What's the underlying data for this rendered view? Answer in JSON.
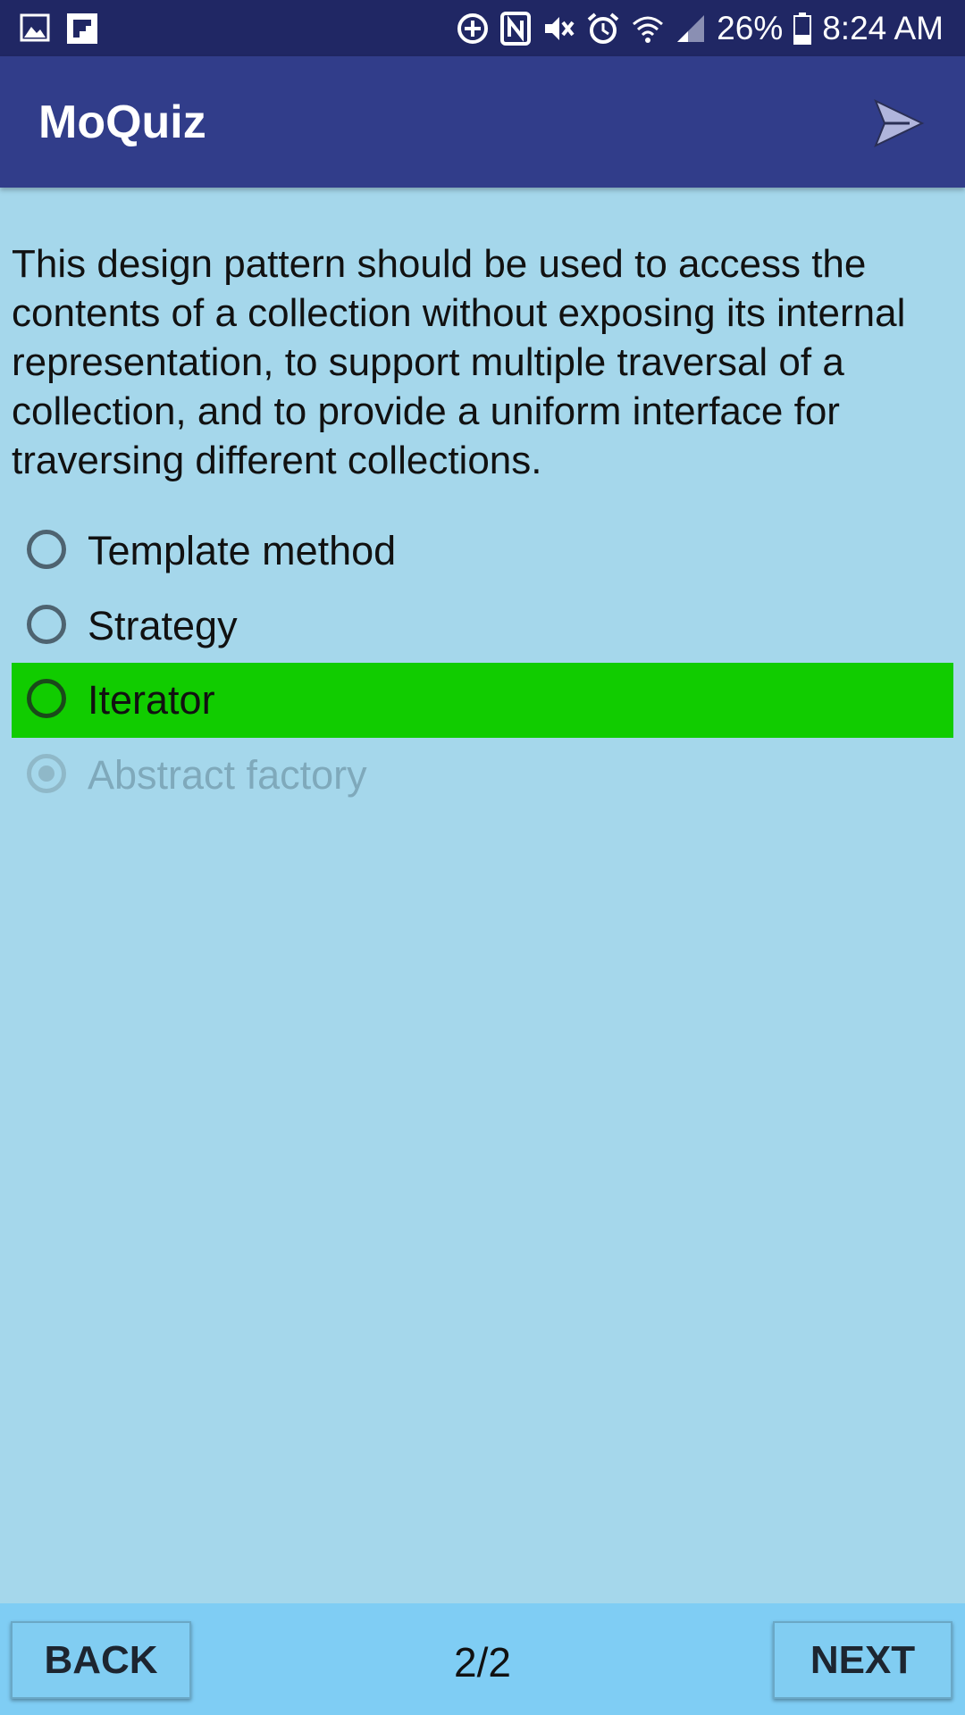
{
  "status_bar": {
    "icons_left": [
      "gallery-icon",
      "flipboard-icon"
    ],
    "icons_right": [
      "data-saver-icon",
      "nfc-icon",
      "mute-icon",
      "alarm-icon",
      "wifi-icon",
      "signal-icon",
      "battery-icon"
    ],
    "battery": "26%",
    "time": "8:24 AM"
  },
  "app_bar": {
    "title": "MoQuiz",
    "send_icon": "send-icon"
  },
  "question": {
    "text": "This design pattern should be used to access the contents of a collection without exposing its internal representation, to support multiple traversal of a collection, and to provide a uniform interface for traversing different collections."
  },
  "options": [
    {
      "label": "Template method",
      "state": "unselected"
    },
    {
      "label": "Strategy",
      "state": "unselected"
    },
    {
      "label": "Iterator",
      "state": "correct"
    },
    {
      "label": "Abstract factory",
      "state": "selected-disabled"
    }
  ],
  "colors": {
    "status_bar": "#202764",
    "app_bar": "#313d8a",
    "background": "#a5d7eb",
    "correct_highlight": "#11cc00",
    "bottom_bar": "#7fcdf4"
  },
  "bottom_bar": {
    "back_label": "BACK",
    "page_counter": "2/2",
    "next_label": "NEXT"
  }
}
